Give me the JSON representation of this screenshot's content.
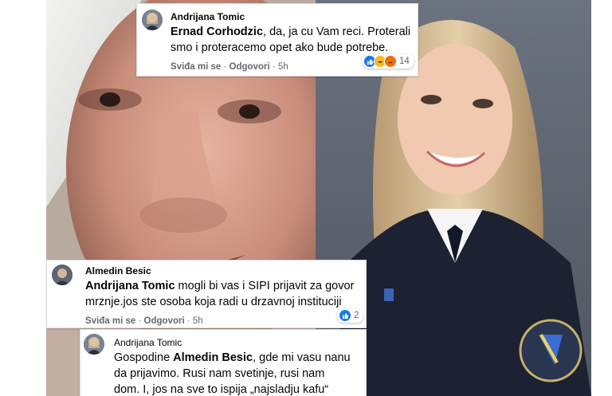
{
  "comments": [
    {
      "author": "Andrijana Tomic",
      "mention": "Ernad Corhodzic",
      "text_line1": ", da, ja cu Vam reci. Proterali",
      "text_line2": "smo i proteracemo opet ako bude potrebe.",
      "like": "Sviđa mi se",
      "reply": "Odgovori",
      "time": "5h",
      "reaction_count": "14"
    },
    {
      "author": "Almedin Besic",
      "mention": "Andrijana Tomic",
      "text_line1": " mogli bi vas i SIPI prijavit za govor",
      "text_line2": "mrznje.jos ste osoba koja radi u drzavnoj instituciji",
      "like": "Sviđa mi se",
      "reply": "Odgovori",
      "time": "5h",
      "reaction_count": "2"
    },
    {
      "author": "Andrijana Tomic",
      "prefix": "Gospodine ",
      "mention": "Almedin Besic",
      "text_line1": ", gde mi vasu nanu",
      "text_line2": "da prijavimo. Rusi nam svetinje, rusi nam",
      "text_line3": "dom. I, jos na sve to ispija „najsladju kafu“"
    }
  ],
  "colors": {
    "like_blue": "#1877f2",
    "haha_yellow": "#f7b928",
    "angry_orange": "#e9710f",
    "text": "#050505",
    "meta": "#65676b"
  },
  "icons": [
    "thumbs-up-icon",
    "haha-icon",
    "angry-icon"
  ]
}
